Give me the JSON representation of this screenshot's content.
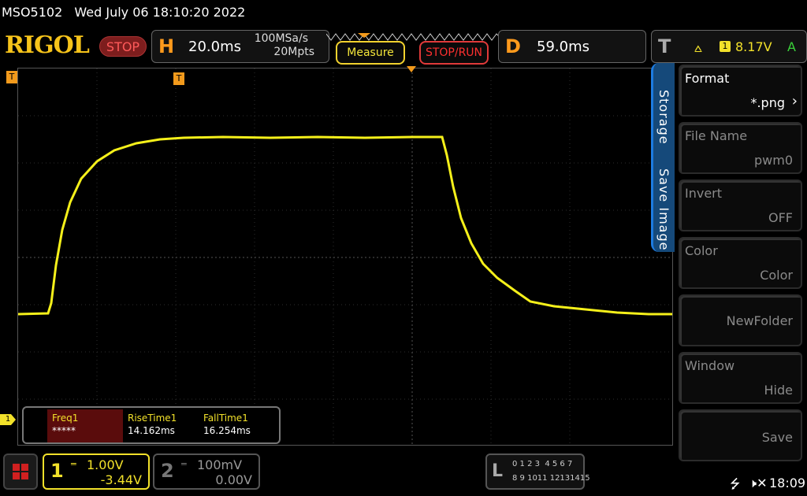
{
  "titlebar": {
    "model": "MSO5102",
    "datetime": "Wed July 06 18:10:20 2022"
  },
  "logo": "RIGOL",
  "run_state": "STOP",
  "horizontal": {
    "letter": "H",
    "timebase": "20.0ms",
    "sample_rate": "100MSa/s",
    "memory": "20Mpts"
  },
  "buttons": {
    "measure": "Measure",
    "stoprun": "STOP/RUN"
  },
  "delay": {
    "letter": "D",
    "value": "59.0ms"
  },
  "trigger": {
    "letter": "T",
    "channel": "1",
    "level": "8.17V",
    "mode": "A"
  },
  "side_tabs": {
    "storage": "Storage",
    "save_image": "Save Image"
  },
  "menu": {
    "format": {
      "title": "Format",
      "value": "*.png"
    },
    "file_name": {
      "title": "File Name",
      "value": "pwm0"
    },
    "invert": {
      "title": "Invert",
      "value": "OFF"
    },
    "color": {
      "title": "Color",
      "value": "Color"
    },
    "new_folder": {
      "value": "NewFolder"
    },
    "window": {
      "title": "Window",
      "value": "Hide"
    },
    "save": {
      "value": "Save"
    }
  },
  "measurements": {
    "freq": {
      "label": "Freq1",
      "value": "*****"
    },
    "rise": {
      "label": "RiseTime1",
      "value": "14.162ms"
    },
    "fall": {
      "label": "FallTime1",
      "value": "16.254ms"
    }
  },
  "channel1": {
    "num": "1",
    "scale": "1.00V",
    "offset": "-3.44V"
  },
  "channel2": {
    "num": "2",
    "scale": "100mV",
    "offset": "0.00V"
  },
  "logic": {
    "letter": "L",
    "row1": "0 1 2 3  4 5 6 7",
    "row2": "8 9 1011 12131415"
  },
  "status": {
    "time": "18:09"
  },
  "colors": {
    "trace": "#f5f01a",
    "accent": "#f29a1c",
    "grid": "#3a3a3a"
  }
}
